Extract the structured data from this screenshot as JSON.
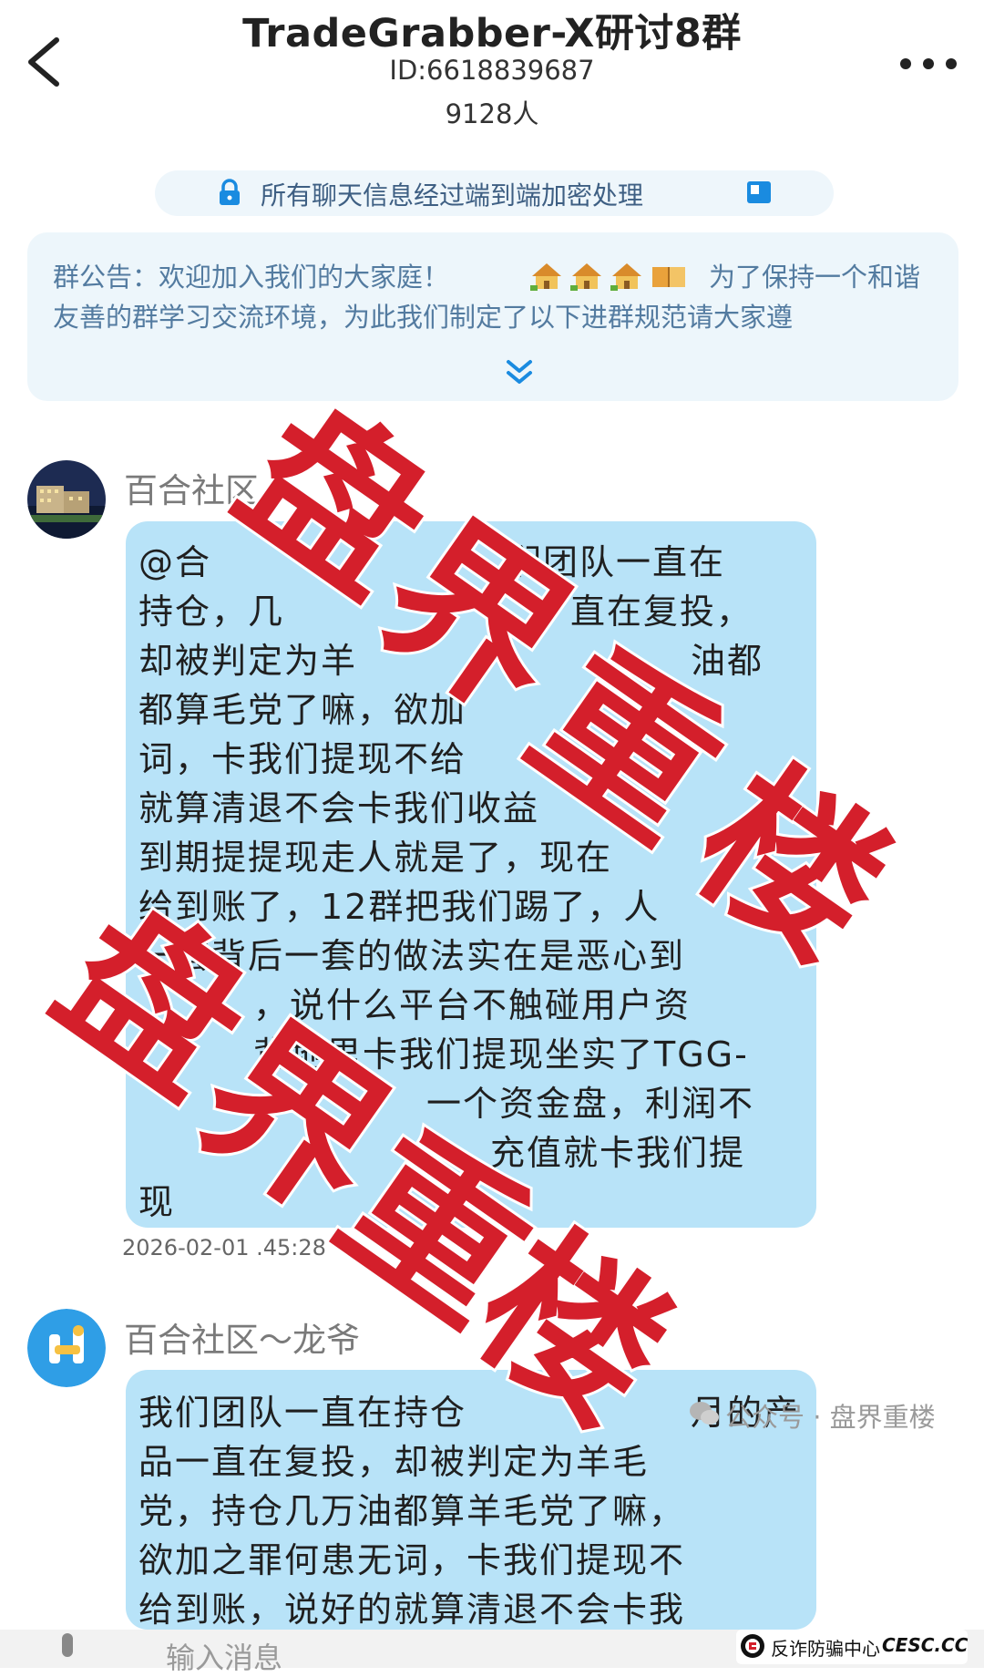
{
  "header": {
    "title": "TradeGrabber-X研讨8群",
    "group_id": "ID:6618839687",
    "member_count": "9128人",
    "back_icon": "chevron-left-icon",
    "more_icon": "more-dots-icon"
  },
  "encryption_notice": "所有聊天信息经过端到端加密处理",
  "announcement": {
    "line1": "群公告：欢迎加入我们的大家庭！",
    "line1_tail": "为了保持一个和谐",
    "line2": "友善的群学习交流环境，为此我们制定了以下进群规范请大家遵",
    "expand_icon": "double-chevron-down-icon"
  },
  "messages": [
    {
      "sender": "百合社区",
      "lines": [
        "@合",
        "持仓，几",
        "却被判定为羊",
        "都算毛党了嘛，欲加",
        "词，卡我们提现不给",
        "就算清退不会卡我们收益",
        "到期提提现走人就是了，现在",
        "给到账了，12群把我们踢了，人",
        "一套背后一套的做法实在是恶心到",
        "，说什么平台不触碰用户资",
        "背地里卡我们提现坐实了TGG-",
        "一个资金盘，利润不",
        "充值就卡我们提",
        "现"
      ],
      "lines_right": [
        "们团队一直在",
        "直在复投，",
        "油都",
        "",
        "",
        "",
        "",
        "",
        "",
        "",
        "",
        "",
        "",
        ""
      ],
      "timestamp": "2026-02-01 .45:28"
    },
    {
      "sender": "百合社区～龙爷",
      "lines": [
        "我们团队一直在持仓",
        "品一直在复投，却被判定为羊毛",
        "党，持仓几万油都算羊毛党了嘛，",
        "欲加之罪何患无词，卡我们提现不",
        "给到账，说好的就算清退不会卡我"
      ],
      "lines_right": [
        "月的产",
        "",
        "",
        "",
        ""
      ]
    }
  ],
  "stamp_text": "盘界重楼",
  "watermark": "公众号 · 盘界重楼",
  "input_placeholder": "输入消息",
  "anti_fraud": {
    "label": "反诈防骗中心",
    "site": "CESC.CC"
  },
  "colors": {
    "bubble": "#b8e3f8",
    "notice_bg": "#edf6fb",
    "stamp_red": "#d41f2b",
    "link_blue": "#3e5f83"
  }
}
